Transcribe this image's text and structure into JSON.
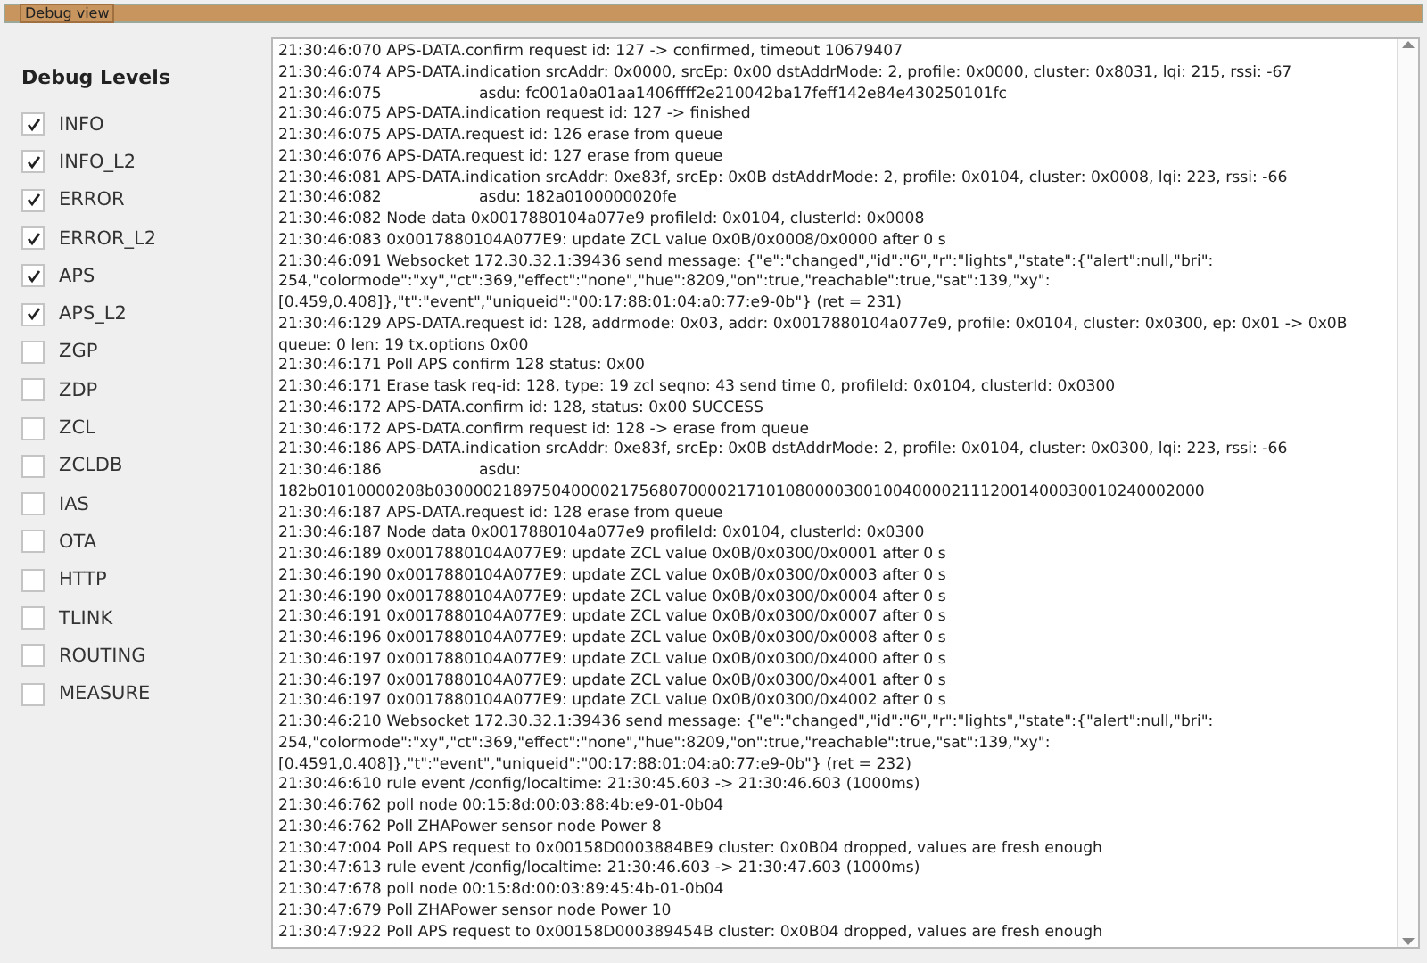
{
  "window": {
    "title": "Debug view"
  },
  "levels_title": "Debug Levels",
  "levels": [
    {
      "label": "INFO",
      "checked": true
    },
    {
      "label": "INFO_L2",
      "checked": true
    },
    {
      "label": "ERROR",
      "checked": true
    },
    {
      "label": "ERROR_L2",
      "checked": true
    },
    {
      "label": "APS",
      "checked": true
    },
    {
      "label": "APS_L2",
      "checked": true
    },
    {
      "label": "ZGP",
      "checked": false
    },
    {
      "label": "ZDP",
      "checked": false
    },
    {
      "label": "ZCL",
      "checked": false
    },
    {
      "label": "ZCLDB",
      "checked": false
    },
    {
      "label": "IAS",
      "checked": false
    },
    {
      "label": "OTA",
      "checked": false
    },
    {
      "label": "HTTP",
      "checked": false
    },
    {
      "label": "TLINK",
      "checked": false
    },
    {
      "label": "ROUTING",
      "checked": false
    },
    {
      "label": "MEASURE",
      "checked": false
    }
  ],
  "log_lines": [
    "21:30:46:070 APS-DATA.confirm request id: 127 -> confirmed, timeout 10679407",
    "21:30:46:074 APS-DATA.indication srcAddr: 0x0000, srcEp: 0x00 dstAddrMode: 2, profile: 0x0000, cluster: 0x8031, lqi: 215, rssi: -67",
    "21:30:46:075                    asdu: fc001a0a01aa1406ffff2e210042ba17feff142e84e430250101fc",
    "21:30:46:075 APS-DATA.indication request id: 127 -> finished",
    "21:30:46:075 APS-DATA.request id: 126 erase from queue",
    "21:30:46:076 APS-DATA.request id: 127 erase from queue",
    "21:30:46:081 APS-DATA.indication srcAddr: 0xe83f, srcEp: 0x0B dstAddrMode: 2, profile: 0x0104, cluster: 0x0008, lqi: 223, rssi: -66",
    "21:30:46:082                    asdu: 182a0100000020fe",
    "21:30:46:082 Node data 0x0017880104a077e9 profileId: 0x0104, clusterId: 0x0008",
    "21:30:46:083 0x0017880104A077E9: update ZCL value 0x0B/0x0008/0x0000 after 0 s",
    "21:30:46:091 Websocket 172.30.32.1:39436 send message: {\"e\":\"changed\",\"id\":\"6\",\"r\":\"lights\",\"state\":{\"alert\":null,\"bri\":",
    "254,\"colormode\":\"xy\",\"ct\":369,\"effect\":\"none\",\"hue\":8209,\"on\":true,\"reachable\":true,\"sat\":139,\"xy\":",
    "[0.459,0.408]},\"t\":\"event\",\"uniqueid\":\"00:17:88:01:04:a0:77:e9-0b\"} (ret = 231)",
    "21:30:46:129 APS-DATA.request id: 128, addrmode: 0x03, addr: 0x0017880104a077e9, profile: 0x0104, cluster: 0x0300, ep: 0x01 -> 0x0B",
    "queue: 0 len: 19 tx.options 0x00",
    "21:30:46:171 Poll APS confirm 128 status: 0x00",
    "21:30:46:171 Erase task req-id: 128, type: 19 zcl seqno: 43 send time 0, profileId: 0x0104, clusterId: 0x0300",
    "21:30:46:172 APS-DATA.confirm id: 128, status: 0x00 SUCCESS",
    "21:30:46:172 APS-DATA.confirm request id: 128 -> erase from queue",
    "21:30:46:186 APS-DATA.indication srcAddr: 0xe83f, srcEp: 0x0B dstAddrMode: 2, profile: 0x0104, cluster: 0x0300, lqi: 223, rssi: -66",
    "21:30:46:186                    asdu:",
    "182b01010000208b0300002189750400002175680700002171010800003001004000021112001400030010240002000",
    "21:30:46:187 APS-DATA.request id: 128 erase from queue",
    "21:30:46:187 Node data 0x0017880104a077e9 profileId: 0x0104, clusterId: 0x0300",
    "21:30:46:189 0x0017880104A077E9: update ZCL value 0x0B/0x0300/0x0001 after 0 s",
    "21:30:46:190 0x0017880104A077E9: update ZCL value 0x0B/0x0300/0x0003 after 0 s",
    "21:30:46:190 0x0017880104A077E9: update ZCL value 0x0B/0x0300/0x0004 after 0 s",
    "21:30:46:191 0x0017880104A077E9: update ZCL value 0x0B/0x0300/0x0007 after 0 s",
    "21:30:46:196 0x0017880104A077E9: update ZCL value 0x0B/0x0300/0x0008 after 0 s",
    "21:30:46:197 0x0017880104A077E9: update ZCL value 0x0B/0x0300/0x4000 after 0 s",
    "21:30:46:197 0x0017880104A077E9: update ZCL value 0x0B/0x0300/0x4001 after 0 s",
    "21:30:46:197 0x0017880104A077E9: update ZCL value 0x0B/0x0300/0x4002 after 0 s",
    "21:30:46:210 Websocket 172.30.32.1:39436 send message: {\"e\":\"changed\",\"id\":\"6\",\"r\":\"lights\",\"state\":{\"alert\":null,\"bri\":",
    "254,\"colormode\":\"xy\",\"ct\":369,\"effect\":\"none\",\"hue\":8209,\"on\":true,\"reachable\":true,\"sat\":139,\"xy\":",
    "[0.4591,0.408]},\"t\":\"event\",\"uniqueid\":\"00:17:88:01:04:a0:77:e9-0b\"} (ret = 232)",
    "21:30:46:610 rule event /config/localtime: 21:30:45.603 -> 21:30:46.603 (1000ms)",
    "21:30:46:762 poll node 00:15:8d:00:03:88:4b:e9-01-0b04",
    "21:30:46:762 Poll ZHAPower sensor node Power 8",
    "21:30:47:004 Poll APS request to 0x00158D0003884BE9 cluster: 0x0B04 dropped, values are fresh enough",
    "21:30:47:613 rule event /config/localtime: 21:30:46.603 -> 21:30:47.603 (1000ms)",
    "21:30:47:678 poll node 00:15:8d:00:03:89:45:4b-01-0b04",
    "21:30:47:679 Poll ZHAPower sensor node Power 10",
    "21:30:47:922 Poll APS request to 0x00158D000389454B cluster: 0x0B04 dropped, values are fresh enough"
  ]
}
